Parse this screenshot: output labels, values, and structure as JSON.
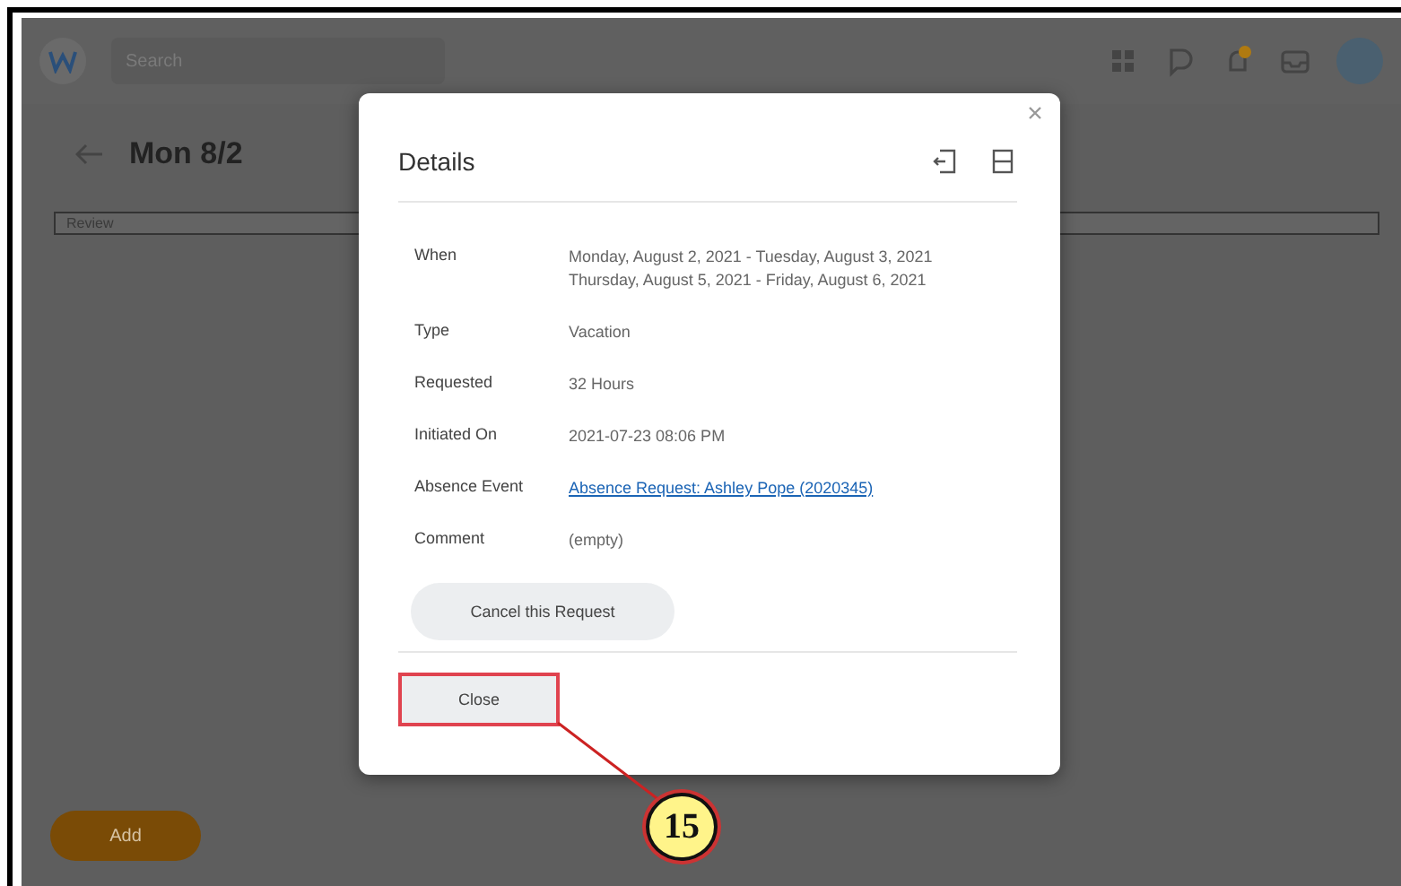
{
  "app": {
    "search": {
      "placeholder": "Search"
    },
    "page_title": "Mon 8/2",
    "filter": "Review",
    "add_button": "Add"
  },
  "dialog": {
    "title": "Details",
    "fields": [
      {
        "kind": "text",
        "label": "When",
        "lines": [
          "Monday, August 2, 2021 - Tuesday, August 3, 2021",
          "Thursday, August 5, 2021 - Friday, August 6, 2021"
        ]
      },
      {
        "kind": "text",
        "label": "Type",
        "lines": [
          "Vacation"
        ]
      },
      {
        "kind": "text",
        "label": "Requested",
        "lines": [
          "32 Hours"
        ]
      },
      {
        "kind": "text",
        "label": "Initiated On",
        "lines": [
          "2021-07-23 08:06 PM"
        ]
      },
      {
        "kind": "link",
        "label": "Absence Event",
        "lines": [
          "Absence Request: Ashley Pope (2020345)"
        ]
      },
      {
        "kind": "text",
        "label": "Comment",
        "lines": [
          "(empty)"
        ]
      }
    ],
    "action_button": "Cancel this Request",
    "close_button": "Close"
  },
  "callout": {
    "number": "15"
  }
}
